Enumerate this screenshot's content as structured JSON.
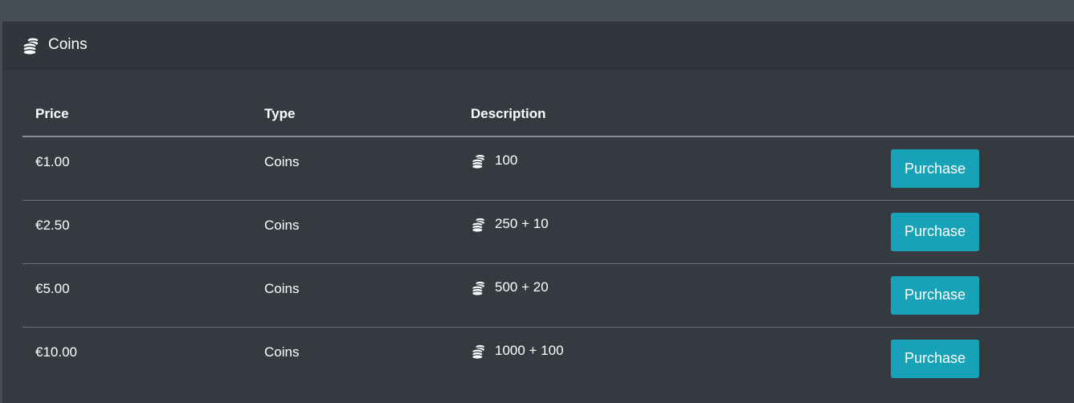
{
  "card": {
    "title": "Coins",
    "icon": "coins-icon"
  },
  "table": {
    "headers": [
      "Price",
      "Type",
      "Description",
      ""
    ],
    "rows": [
      {
        "price": "€1.00",
        "type": "Coins",
        "description": "100",
        "button": "Purchase"
      },
      {
        "price": "€2.50",
        "type": "Coins",
        "description": "250 + 10",
        "button": "Purchase"
      },
      {
        "price": "€5.00",
        "type": "Coins",
        "description": "500 + 20",
        "button": "Purchase"
      },
      {
        "price": "€10.00",
        "type": "Coins",
        "description": "1000 + 100",
        "button": "Purchase"
      }
    ]
  },
  "colors": {
    "background": "#474e56",
    "card": "#343a40",
    "button": "#17a2b8",
    "text": "#ffffff"
  }
}
